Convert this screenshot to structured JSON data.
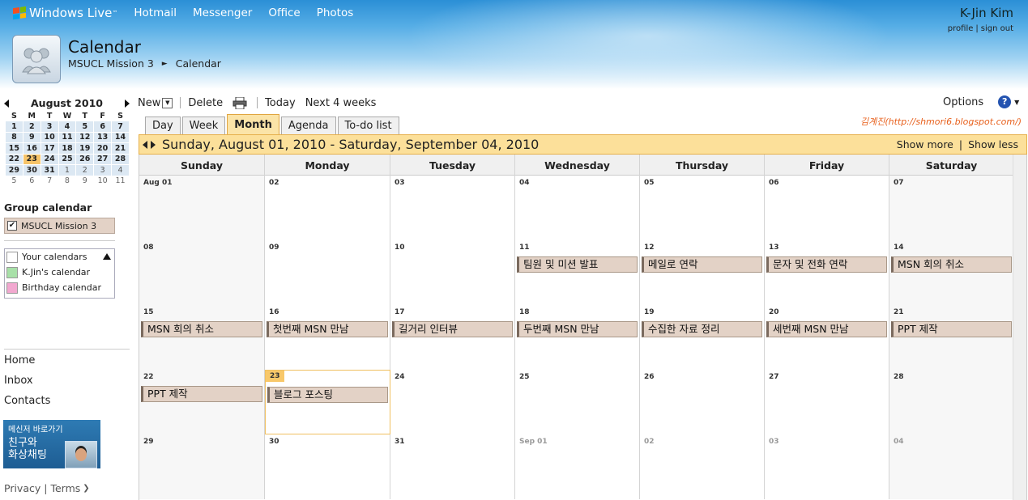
{
  "topnav": {
    "brand": "Windows Live",
    "brand_tm": "™",
    "links": [
      "Hotmail",
      "Messenger",
      "Office",
      "Photos"
    ]
  },
  "user": {
    "name": "K-Jin Kim",
    "profile": "profile",
    "signout": "sign out"
  },
  "app": {
    "title": "Calendar",
    "breadcrumb_group": "MSUCL Mission 3",
    "breadcrumb_current": "Calendar"
  },
  "mini_calendar": {
    "month": "August 2010",
    "weekdays": [
      "S",
      "M",
      "T",
      "W",
      "T",
      "F",
      "S"
    ],
    "weeks": [
      [
        "1",
        "2",
        "3",
        "4",
        "5",
        "6",
        "7"
      ],
      [
        "8",
        "9",
        "10",
        "11",
        "12",
        "13",
        "14"
      ],
      [
        "15",
        "16",
        "17",
        "18",
        "19",
        "20",
        "21"
      ],
      [
        "22",
        "23",
        "24",
        "25",
        "26",
        "27",
        "28"
      ],
      [
        "29",
        "30",
        "31",
        "1",
        "2",
        "3",
        "4"
      ],
      [
        "5",
        "6",
        "7",
        "8",
        "9",
        "10",
        "11"
      ]
    ]
  },
  "group_calendar": {
    "title": "Group calendar",
    "item": "MSUCL Mission 3"
  },
  "your_calendars": {
    "title": "Your calendars",
    "items": [
      "K.Jin's calendar",
      "Birthday calendar"
    ],
    "colors": [
      "#a8e0a8",
      "#f2a8d0"
    ]
  },
  "sidelinks": [
    "Home",
    "Inbox",
    "Contacts"
  ],
  "ad": {
    "line1": "메신저 바로가기",
    "line2": "친구와",
    "line3": "화상채팅"
  },
  "footer": {
    "privacy": "Privacy",
    "terms": "Terms"
  },
  "toolbar": {
    "new": "New",
    "delete": "Delete",
    "today": "Today",
    "next": "Next 4 weeks",
    "options": "Options",
    "help": "?"
  },
  "tabs": [
    "Day",
    "Week",
    "Month",
    "Agenda",
    "To-do list"
  ],
  "credit": "김계진(http://shmori6.blogspot.com/)",
  "range": {
    "title": "Sunday, August 01, 2010 - Saturday, September 04, 2010",
    "show_more": "Show more",
    "show_less": "Show less"
  },
  "calendar": {
    "day_headers": [
      "Sunday",
      "Monday",
      "Tuesday",
      "Wednesday",
      "Thursday",
      "Friday",
      "Saturday"
    ],
    "weeks": [
      [
        {
          "d": "Aug 01"
        },
        {
          "d": "02"
        },
        {
          "d": "03"
        },
        {
          "d": "04"
        },
        {
          "d": "05"
        },
        {
          "d": "06"
        },
        {
          "d": "07"
        }
      ],
      [
        {
          "d": "08"
        },
        {
          "d": "09"
        },
        {
          "d": "10"
        },
        {
          "d": "11",
          "e": "팀원 및 미션 발표"
        },
        {
          "d": "12",
          "e": "메일로 연락"
        },
        {
          "d": "13",
          "e": "문자 및 전화 연락"
        },
        {
          "d": "14",
          "e": "MSN 회의 취소"
        }
      ],
      [
        {
          "d": "15",
          "e": "MSN 회의 취소"
        },
        {
          "d": "16",
          "e": "첫번째 MSN 만남"
        },
        {
          "d": "17",
          "e": "길거리 인터뷰"
        },
        {
          "d": "18",
          "e": "두번째 MSN 만남"
        },
        {
          "d": "19",
          "e": "수집한 자료 정리"
        },
        {
          "d": "20",
          "e": "세번째 MSN 만남"
        },
        {
          "d": "21",
          "e": "PPT 제작"
        }
      ],
      [
        {
          "d": "22",
          "e": "PPT 제작"
        },
        {
          "d": "23",
          "e": "블로그 포스팅",
          "today": true
        },
        {
          "d": "24"
        },
        {
          "d": "25"
        },
        {
          "d": "26"
        },
        {
          "d": "27"
        },
        {
          "d": "28"
        }
      ],
      [
        {
          "d": "29"
        },
        {
          "d": "30"
        },
        {
          "d": "31"
        },
        {
          "d": "Sep 01",
          "out": true
        },
        {
          "d": "02",
          "out": true
        },
        {
          "d": "03",
          "out": true
        },
        {
          "d": "04",
          "out": true
        }
      ]
    ]
  }
}
